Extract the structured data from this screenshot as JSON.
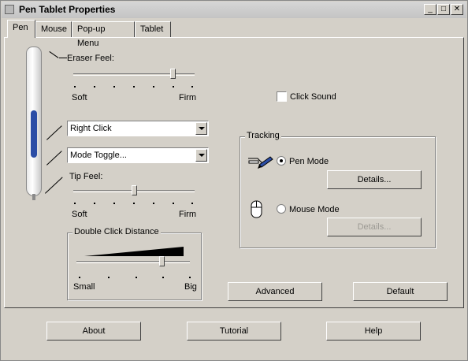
{
  "window": {
    "title": "Pen Tablet Properties"
  },
  "title_buttons": {
    "minimize": "_",
    "maximize": "□",
    "close": "✕"
  },
  "tabs": [
    {
      "label": "Pen",
      "active": true
    },
    {
      "label": "Mouse",
      "active": false
    },
    {
      "label": "Pop-up Menu",
      "active": false
    },
    {
      "label": "Tablet",
      "active": false
    }
  ],
  "eraser_feel": {
    "label": "Eraser Feel:",
    "min_label": "Soft",
    "max_label": "Firm",
    "level": 0.83
  },
  "side_switch_upper": {
    "value": "Right Click"
  },
  "side_switch_lower": {
    "value": "Mode Toggle..."
  },
  "tip_feel": {
    "label": "Tip Feel:",
    "min_label": "Soft",
    "max_label": "Firm",
    "level": 0.5
  },
  "double_click": {
    "title": "Double Click Distance",
    "min_label": "Small",
    "max_label": "Big",
    "level": 0.8
  },
  "click_sound": {
    "label": "Click Sound",
    "checked": false
  },
  "tracking": {
    "title": "Tracking",
    "pen_mode": {
      "label": "Pen Mode",
      "selected": true,
      "details": "Details..."
    },
    "mouse_mode": {
      "label": "Mouse Mode",
      "selected": false,
      "details": "Details..."
    }
  },
  "actions": {
    "advanced": "Advanced",
    "default": "Default"
  },
  "footer": {
    "about": "About",
    "tutorial": "Tutorial",
    "help": "Help"
  },
  "colors": {
    "face": "#d4d0c8",
    "pen_grip": "#2b4da6"
  },
  "icons": [
    "pen-mode-icon",
    "mouse-mode-icon",
    "pen-illustration"
  ]
}
